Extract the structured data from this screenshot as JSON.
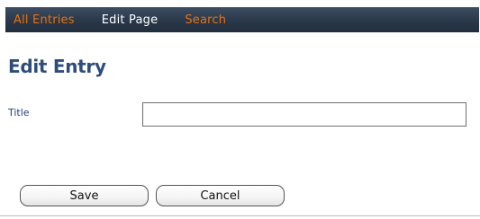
{
  "nav": {
    "items": [
      {
        "label": "All Entries",
        "color": "#e8720c"
      },
      {
        "label": "Edit Page",
        "color": "#ffffff"
      },
      {
        "label": "Search",
        "color": "#e8720c"
      }
    ],
    "background": "#2a384a"
  },
  "page": {
    "title": "Edit Entry",
    "title_color": "#2e4d7a"
  },
  "form": {
    "title_label": "Title",
    "title_value": "",
    "title_placeholder": ""
  },
  "buttons": {
    "save": "Save",
    "cancel": "Cancel"
  }
}
